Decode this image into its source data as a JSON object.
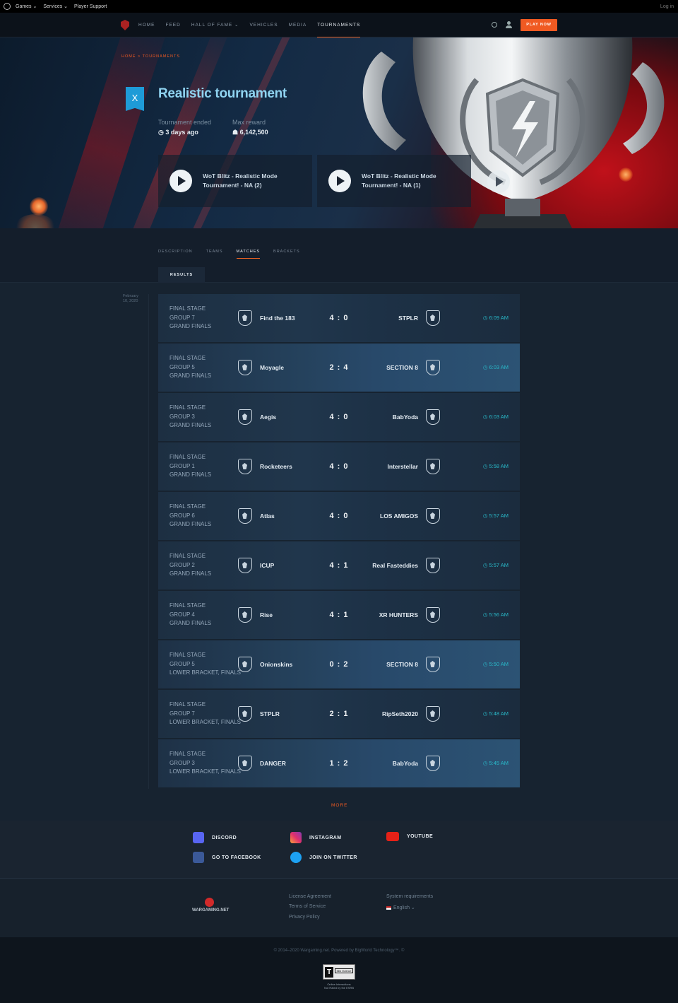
{
  "topbar": {
    "games": "Games ⌄",
    "services": "Services ⌄",
    "support": "Player Support",
    "login": "Log in"
  },
  "nav": {
    "items": [
      "HOME",
      "FEED",
      "HALL OF FAME ⌄",
      "VEHICLES",
      "MEDIA",
      "TOURNAMENTS"
    ],
    "active": "TOURNAMENTS",
    "play_now": "PLAY NOW"
  },
  "hero": {
    "breadcrumb": "HOME > TOURNAMENTS",
    "badge": "X",
    "title": "Realistic tournament",
    "ended_label": "Tournament ended",
    "ended_value": "◷ 3 days ago",
    "reward_label": "Max reward",
    "reward_value": "☗ 6,142,500",
    "videos": [
      {
        "title": "WoT Blitz - Realistic Mode Tournament! - NA (2)"
      },
      {
        "title": "WoT Blitz - Realistic Mode Tournament! - NA (1)"
      }
    ]
  },
  "tabs": {
    "items": [
      "DESCRIPTION",
      "TEAMS",
      "MATCHES",
      "BRACKETS"
    ],
    "active": "MATCHES",
    "subtab": "RESULTS"
  },
  "date_label": {
    "line1": "February",
    "line2": "10, 2020"
  },
  "matches": [
    {
      "stage": "FINAL STAGE",
      "group": "GROUP 7",
      "round": "GRAND FINALS",
      "team1": "Find the 183",
      "score": "4 : 0",
      "team2": "STPLR",
      "time": "◷ 6:09 AM",
      "highlight": false
    },
    {
      "stage": "FINAL STAGE",
      "group": "GROUP 5",
      "round": "GRAND FINALS",
      "team1": "Moyagle",
      "score": "2 : 4",
      "team2": "SECTION 8",
      "time": "◷ 6:03 AM",
      "highlight": true
    },
    {
      "stage": "FINAL STAGE",
      "group": "GROUP 3",
      "round": "GRAND FINALS",
      "team1": "Aegis",
      "score": "4 : 0",
      "team2": "BabYoda",
      "time": "◷ 6:03 AM",
      "highlight": false
    },
    {
      "stage": "FINAL STAGE",
      "group": "GROUP 1",
      "round": "GRAND FINALS",
      "team1": "Rocketeers",
      "score": "4 : 0",
      "team2": "Interstellar",
      "time": "◷ 5:58 AM",
      "highlight": false
    },
    {
      "stage": "FINAL STAGE",
      "group": "GROUP 6",
      "round": "GRAND FINALS",
      "team1": "Atlas",
      "score": "4 : 0",
      "team2": "LOS AMIGOS",
      "time": "◷ 5:57 AM",
      "highlight": false
    },
    {
      "stage": "FINAL STAGE",
      "group": "GROUP 2",
      "round": "GRAND FINALS",
      "team1": "ICUP",
      "score": "4 : 1",
      "team2": "Real Fasteddies",
      "time": "◷ 5:57 AM",
      "highlight": false
    },
    {
      "stage": "FINAL STAGE",
      "group": "GROUP 4",
      "round": "GRAND FINALS",
      "team1": "Rise",
      "score": "4 : 1",
      "team2": "XR HUNTERS",
      "time": "◷ 5:56 AM",
      "highlight": false
    },
    {
      "stage": "FINAL STAGE",
      "group": "GROUP 5",
      "round": "LOWER BRACKET, FINALS",
      "team1": "Onionskins",
      "score": "0 : 2",
      "team2": "SECTION 8",
      "time": "◷ 5:50 AM",
      "highlight": true
    },
    {
      "stage": "FINAL STAGE",
      "group": "GROUP 7",
      "round": "LOWER BRACKET, FINALS",
      "team1": "STPLR",
      "score": "2 : 1",
      "team2": "RipSeth2020",
      "time": "◷ 5:48 AM",
      "highlight": false
    },
    {
      "stage": "FINAL STAGE",
      "group": "GROUP 3",
      "round": "LOWER BRACKET, FINALS",
      "team1": "DANGER",
      "score": "1 : 2",
      "team2": "BabYoda",
      "time": "◷ 5:45 AM",
      "highlight": true
    }
  ],
  "more": "MORE",
  "social": {
    "discord": "DISCORD",
    "instagram": "INSTAGRAM",
    "youtube": "YOUTUBE",
    "facebook": "GO TO FACEBOOK",
    "twitter": "JOIN ON TWITTER"
  },
  "footer": {
    "brand": "WARGAMING.NET",
    "license": "License Agreement",
    "terms": "Terms of Service",
    "privacy": "Privacy Policy",
    "sysreq": "System requirements",
    "language": "English ⌄",
    "copyright": "© 2014–2020 Wargaming.net. Powered by BigWorld Technology™. ©",
    "esrb_rating": "T",
    "esrb_desc": "Mild Violence",
    "esrb_note1": "Online Interactions",
    "esrb_note2": "Not Rated by the ESRB"
  },
  "colors": {
    "accent": "#f05a22",
    "time": "#29b9c9",
    "title": "#8fd3f0"
  }
}
